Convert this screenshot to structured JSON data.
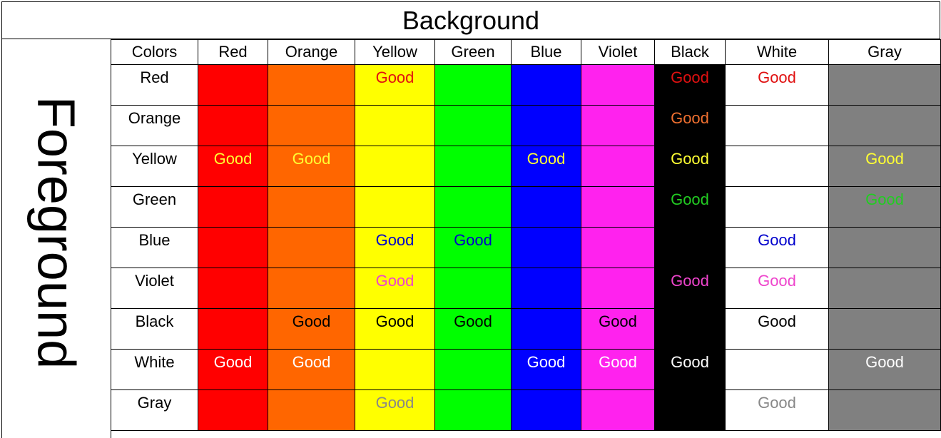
{
  "title": "Background",
  "side_label": "Foreground",
  "corner_label": "Colors",
  "colors": {
    "Red": {
      "bg": "#ff0000",
      "fg": "#e01010"
    },
    "Orange": {
      "bg": "#ff6600",
      "fg": "#f07030"
    },
    "Yellow": {
      "bg": "#ffff00",
      "fg": "#ffff33"
    },
    "Green": {
      "bg": "#00ff00",
      "fg": "#22cc22"
    },
    "Blue": {
      "bg": "#0000ff",
      "fg": "#0000cc"
    },
    "Violet": {
      "bg": "#ff22ee",
      "fg": "#ee44cc"
    },
    "Black": {
      "bg": "#000000",
      "fg": "#000000"
    },
    "White": {
      "bg": "#ffffff",
      "fg": "#ffffff"
    },
    "Gray": {
      "bg": "#808080",
      "fg": "#888888"
    }
  },
  "columns": [
    "Red",
    "Orange",
    "Yellow",
    "Green",
    "Blue",
    "Violet",
    "Black",
    "White",
    "Gray"
  ],
  "rows": [
    {
      "label": "Red",
      "cells": [
        "",
        "",
        "Good",
        "",
        "",
        "",
        "Good",
        "Good",
        ""
      ]
    },
    {
      "label": "Orange",
      "cells": [
        "",
        "",
        "",
        "",
        "",
        "",
        "Good",
        "",
        ""
      ]
    },
    {
      "label": "Yellow",
      "cells": [
        "Good",
        "Good",
        "",
        "",
        "Good",
        "",
        "Good",
        "",
        "Good"
      ]
    },
    {
      "label": "Green",
      "cells": [
        "",
        "",
        "",
        "",
        "",
        "",
        "Good",
        "",
        "Good"
      ]
    },
    {
      "label": "Blue",
      "cells": [
        "",
        "",
        "Good",
        "Good",
        "",
        "",
        "",
        "Good",
        ""
      ]
    },
    {
      "label": "Violet",
      "cells": [
        "",
        "",
        "Good",
        "",
        "",
        "",
        "Good",
        "Good",
        ""
      ]
    },
    {
      "label": "Black",
      "cells": [
        "",
        "Good",
        "Good",
        "Good",
        "",
        "Good",
        "",
        "Good",
        ""
      ]
    },
    {
      "label": "White",
      "cells": [
        "Good",
        "Good",
        "",
        "",
        "Good",
        "Good",
        "Good",
        "",
        "Good"
      ]
    },
    {
      "label": "Gray",
      "cells": [
        "",
        "",
        "Good",
        "",
        "",
        "",
        "",
        "Good",
        ""
      ]
    }
  ]
}
